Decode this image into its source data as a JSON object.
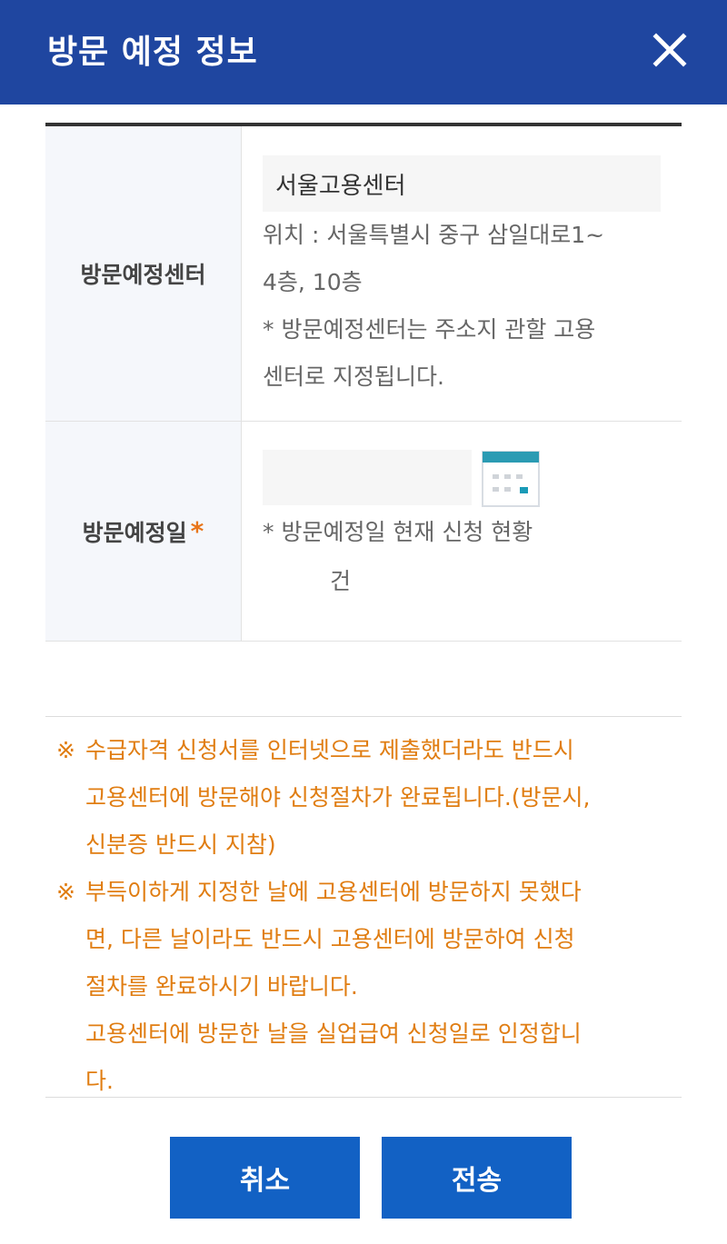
{
  "header": {
    "title": "방문 예정 정보",
    "close_icon": "close-icon"
  },
  "form": {
    "center": {
      "label": "방문예정센터",
      "value": "서울고용센터",
      "location_line1": "위치 : 서울특별시 중구 삼일대로1~",
      "location_line2": "4층, 10층",
      "note_line1": "* 방문예정센터는 주소지 관할 고용",
      "note_line2": "센터로 지정됩니다."
    },
    "date": {
      "label": "방문예정일",
      "required_mark": "*",
      "value": "",
      "calendar_icon": "calendar-icon",
      "status_text": "* 방문예정일 현재 신청 현황",
      "count_unit": "건"
    }
  },
  "notices": [
    {
      "mark": "※",
      "lines": [
        "수급자격 신청서를 인터넷으로 제출했더라도 반드시",
        "고용센터에 방문해야 신청절차가 완료됩니다.(방문시,",
        "신분증 반드시 지참)"
      ]
    },
    {
      "mark": "※",
      "lines": [
        "부득이하게 지정한 날에 고용센터에 방문하지 못했다",
        "면, 다른 날이라도 반드시 고용센터에 방문하여 신청",
        "절차를 완료하시기 바랍니다.",
        "고용센터에 방문한 날을 실업급여 신청일로 인정합니",
        "다."
      ]
    }
  ],
  "buttons": {
    "cancel": "취소",
    "send": "전송"
  },
  "colors": {
    "header_bg": "#1f46a0",
    "button_bg": "#1261c4",
    "notice_text": "#e07d12",
    "required": "#e8751a"
  }
}
